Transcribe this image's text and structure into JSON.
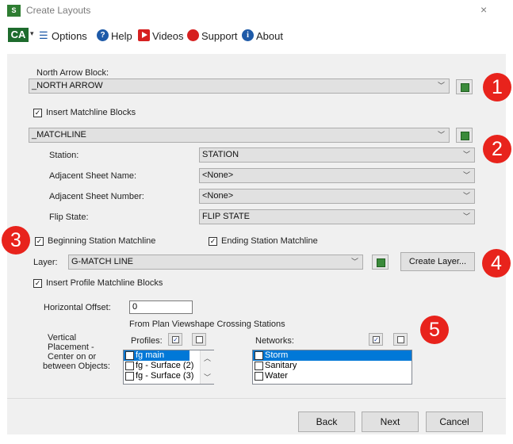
{
  "window": {
    "title": "Create Layouts",
    "logo": "S",
    "close": "×"
  },
  "toolbar": {
    "logo": "CA",
    "options": "Options",
    "help": "Help",
    "videos": "Videos",
    "support": "Support",
    "about": "About"
  },
  "north_arrow": {
    "label": "North Arrow Block:",
    "value": "_NORTH ARROW"
  },
  "insert_matchline": {
    "label": "Insert Matchline Blocks",
    "checked": true
  },
  "matchline": {
    "value": "_MATCHLINE"
  },
  "station": {
    "label": "Station:",
    "value": "STATION"
  },
  "adj_name": {
    "label": "Adjacent Sheet Name:",
    "value": "<None>"
  },
  "adj_number": {
    "label": "Adjacent Sheet Number:",
    "value": "<None>"
  },
  "flip_state": {
    "label": "Flip State:",
    "value": "FLIP STATE"
  },
  "beginning": {
    "label": "Beginning Station Matchline",
    "checked": true
  },
  "ending": {
    "label": "Ending Station Matchline",
    "checked": true
  },
  "layer": {
    "label": "Layer:",
    "value": "G-MATCH LINE",
    "create": "Create Layer..."
  },
  "insert_profile": {
    "label": "Insert Profile Matchline Blocks",
    "checked": true
  },
  "horizontal_offset": {
    "label": "Horizontal Offset:",
    "value": "0"
  },
  "from_plan": "From Plan Viewshape Crossing Stations",
  "vertical_placement": {
    "line1": "Vertical",
    "line2": "Placement -",
    "line3": "Center on or",
    "line4": "between Objects:"
  },
  "profiles": {
    "label": "Profiles:",
    "items": [
      "fg main",
      "fg - Surface (2)",
      "fg - Surface (3)"
    ]
  },
  "networks": {
    "label": "Networks:",
    "items": [
      "Storm",
      "Sanitary",
      "Water"
    ]
  },
  "buttons": {
    "back": "Back",
    "next": "Next",
    "cancel": "Cancel"
  },
  "badges": [
    "1",
    "2",
    "3",
    "4",
    "5"
  ],
  "colors": {
    "badge": "#e8231c",
    "selection": "#0078d7",
    "panel": "#f0f0f0"
  }
}
